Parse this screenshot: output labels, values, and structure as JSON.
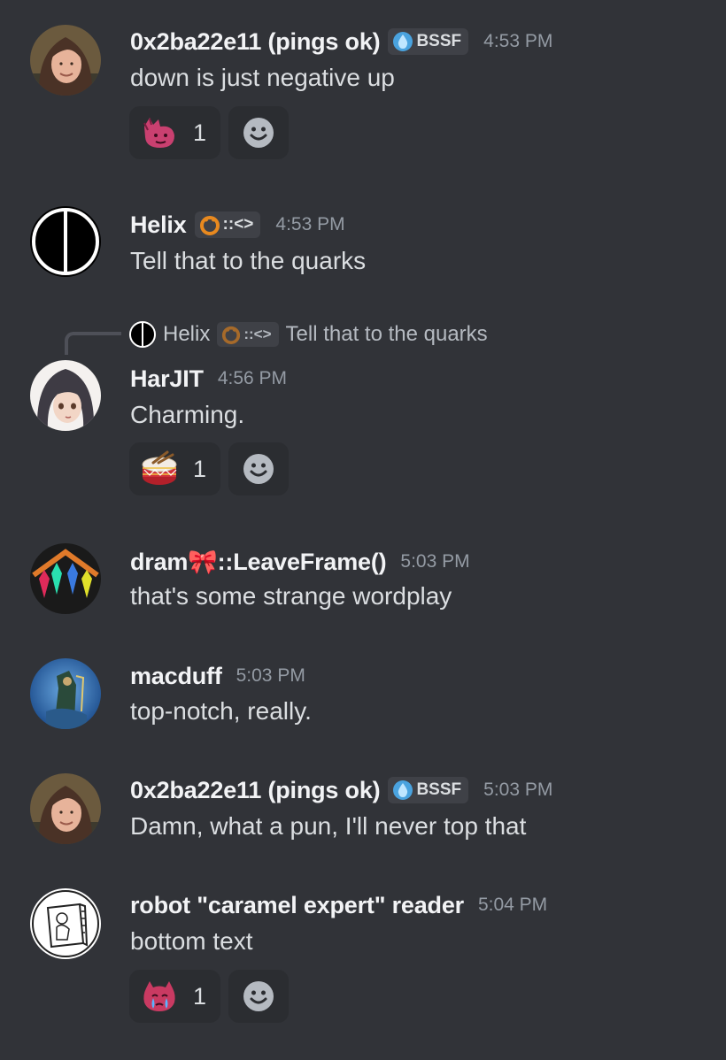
{
  "messages": [
    {
      "username": "0x2ba22e11 (pings ok)",
      "tag": "BSSF",
      "time": "4:53 PM",
      "content": "down is just negative up",
      "reactions": [
        {
          "emoji": "pink-creature-emoji",
          "count": "1"
        }
      ]
    },
    {
      "username": "Helix",
      "tag": "::<>",
      "time": "4:53 PM",
      "content": "Tell that to the quarks"
    },
    {
      "reply": {
        "username": "Helix",
        "tag": "::<>",
        "content": "Tell that to the quarks"
      },
      "username": "HarJIT",
      "time": "4:56 PM",
      "content": "Charming.",
      "reactions": [
        {
          "emoji": "drum-emoji",
          "count": "1"
        }
      ]
    },
    {
      "username": "dram🎀::LeaveFrame()",
      "time": "5:03 PM",
      "content": "that's some strange wordplay"
    },
    {
      "username": "macduff",
      "time": "5:03 PM",
      "content": "top-notch, really."
    },
    {
      "username": "0x2ba22e11 (pings ok)",
      "tag": "BSSF",
      "time": "5:03 PM",
      "content": "Damn, what a pun, I'll never top that"
    },
    {
      "username": "robot \"caramel expert\" reader",
      "time": "5:04 PM",
      "content": "bottom text",
      "reactions": [
        {
          "emoji": "crying-pink-emoji",
          "count": "1"
        }
      ]
    }
  ],
  "colors": {
    "background": "#313338",
    "reaction_bg": "#2b2d31",
    "tag_bg": "#3f4147",
    "username": "#f2f3f5",
    "timestamp": "#949ba4",
    "text": "#dbdee1"
  }
}
